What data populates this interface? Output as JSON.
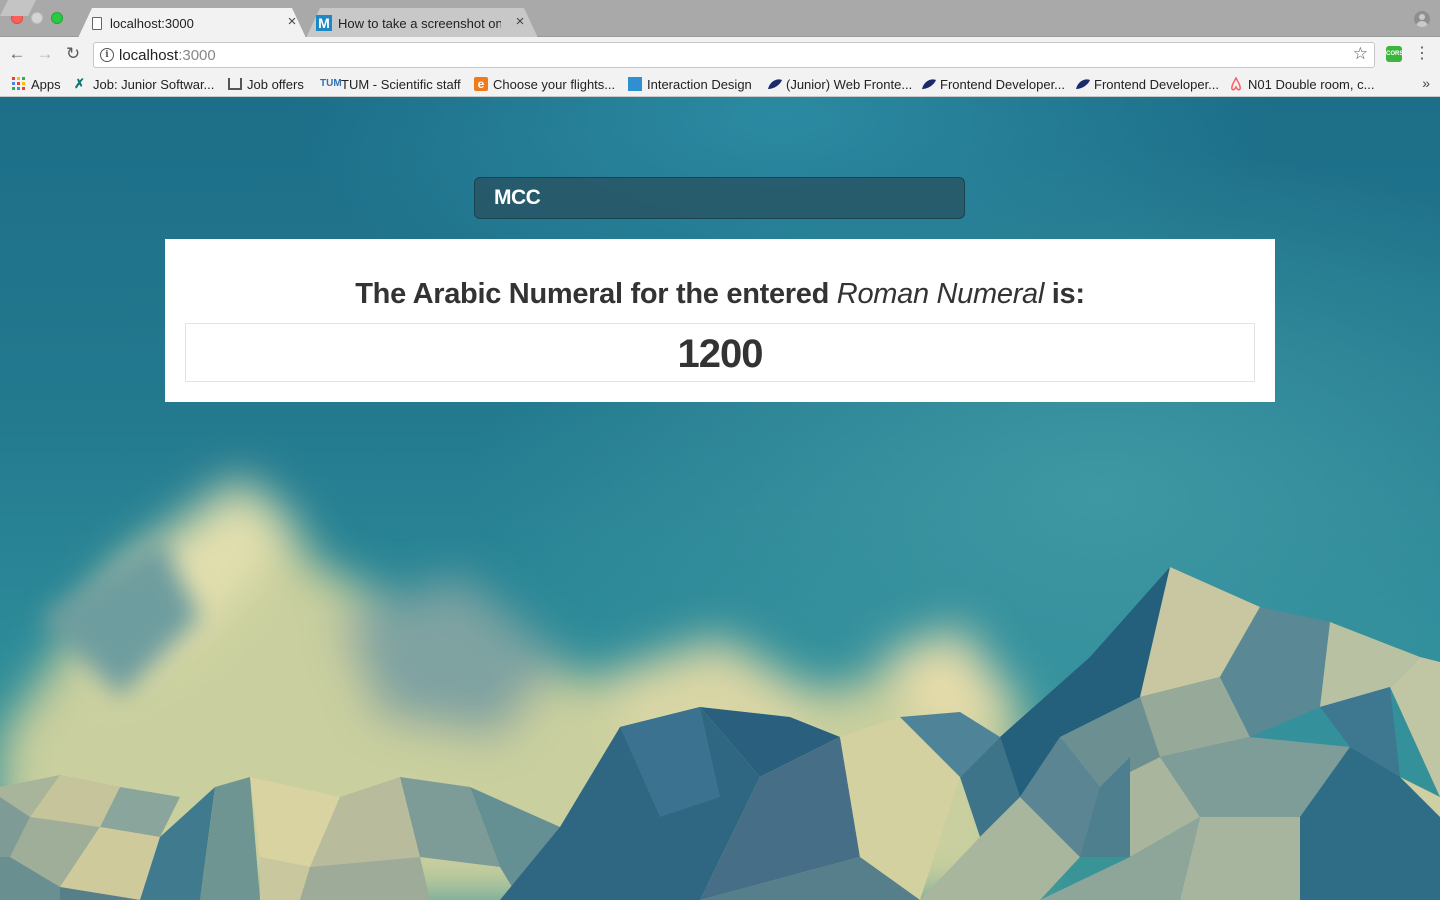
{
  "browser": {
    "tabs": [
      {
        "title": "localhost:3000",
        "active": true
      },
      {
        "title": "How to take a screenshot on M",
        "active": false
      }
    ],
    "address_bar": {
      "host": "localhost",
      "port": ":3000"
    },
    "bookmarks": [
      {
        "label": "Apps",
        "icon": "apps-grid-icon"
      },
      {
        "label": "Job: Junior Softwar...",
        "icon": "xing-icon"
      },
      {
        "label": "Job offers",
        "icon": "stackoverflow-icon"
      },
      {
        "label": "TUM - Scientific staff",
        "icon": "tum-icon"
      },
      {
        "label": "Choose your flights...",
        "icon": "edreams-icon"
      },
      {
        "label": "Interaction Design",
        "icon": "interaction-design-icon"
      },
      {
        "label": "(Junior) Web Fronte...",
        "icon": "job-site-icon"
      },
      {
        "label": "Frontend Developer...",
        "icon": "job-site-icon"
      },
      {
        "label": "Frontend Developer...",
        "icon": "job-site-icon"
      },
      {
        "label": "N01 Double room, c...",
        "icon": "airbnb-icon"
      }
    ],
    "extension_label": "CORS"
  },
  "app": {
    "input_value": "MCC",
    "result_heading_prefix": "The Arabic Numeral for the entered",
    "result_heading_emphasis": "Roman Numeral",
    "result_heading_suffix": "is:",
    "result_value": "1200"
  }
}
